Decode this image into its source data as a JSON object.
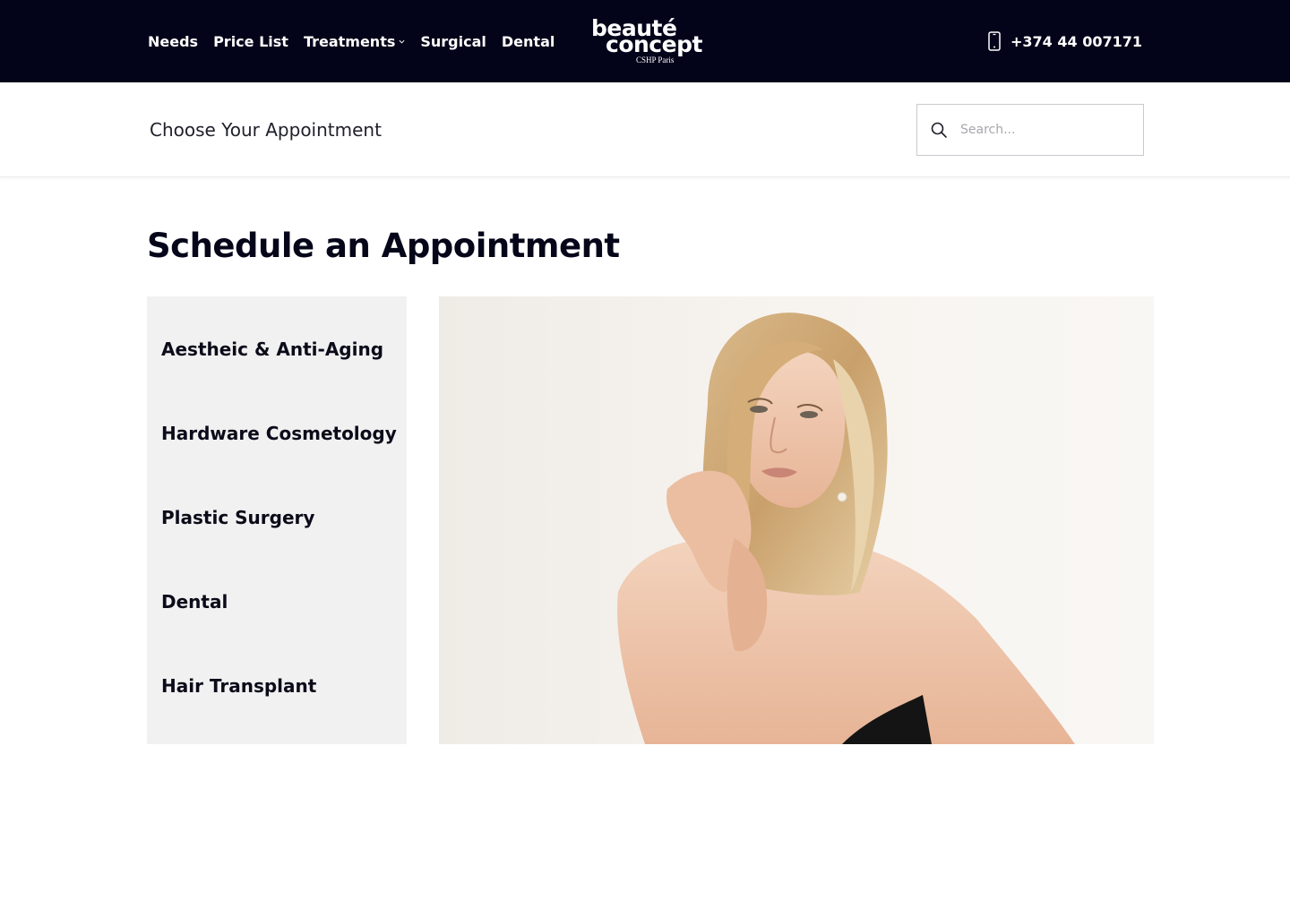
{
  "nav": {
    "items": [
      {
        "label": "Needs"
      },
      {
        "label": "Price List"
      },
      {
        "label": "Treatments",
        "has_dropdown": true
      },
      {
        "label": "Surgical"
      },
      {
        "label": "Dental"
      }
    ],
    "brand": {
      "line1": "beauté",
      "line2": "concept",
      "line3": "CSHP Paris"
    },
    "phone": "+374 44 007171",
    "background_color": "#03031a"
  },
  "subheader": {
    "title": "Choose Your Appointment",
    "search_placeholder": "Search..."
  },
  "main": {
    "title": "Schedule an Appointment",
    "categories": [
      {
        "label": "Aestheic & Anti-Aging"
      },
      {
        "label": "Hardware Cosmetology"
      },
      {
        "label": "Plastic Surgery"
      },
      {
        "label": "Dental"
      },
      {
        "label": "Hair Transplant"
      }
    ]
  }
}
